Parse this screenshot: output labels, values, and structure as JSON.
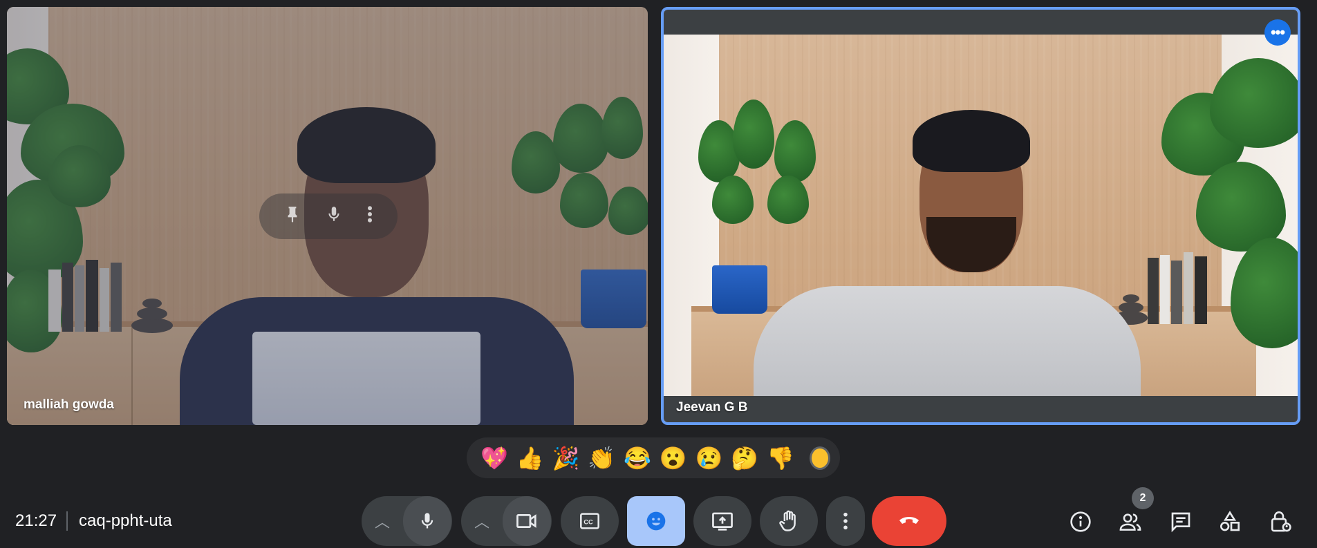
{
  "participants": [
    {
      "name": "malliah gowda",
      "pinned_hover_icons": [
        "pin-icon",
        "mic-icon",
        "more-vert-icon"
      ]
    },
    {
      "name": "Jeevan G B",
      "active_speaker": true
    }
  ],
  "reactions": [
    {
      "emoji": "💖",
      "label": "sparkling-heart"
    },
    {
      "emoji": "👍",
      "label": "thumbs-up"
    },
    {
      "emoji": "🎉",
      "label": "party-popper"
    },
    {
      "emoji": "👏",
      "label": "clapping-hands"
    },
    {
      "emoji": "😂",
      "label": "tears-of-joy"
    },
    {
      "emoji": "😮",
      "label": "open-mouth"
    },
    {
      "emoji": "😢",
      "label": "crying-face"
    },
    {
      "emoji": "🤔",
      "label": "thinking-face"
    },
    {
      "emoji": "👎",
      "label": "thumbs-down"
    }
  ],
  "footer": {
    "time": "21:27",
    "meeting_code": "caq-ppht-uta",
    "participants_count": "2"
  },
  "colors": {
    "background": "#202124",
    "control": "#3c4043",
    "active_emoji_button": "#a8c7fa",
    "end_call": "#ea4335",
    "speaker_border": "#669df6"
  }
}
